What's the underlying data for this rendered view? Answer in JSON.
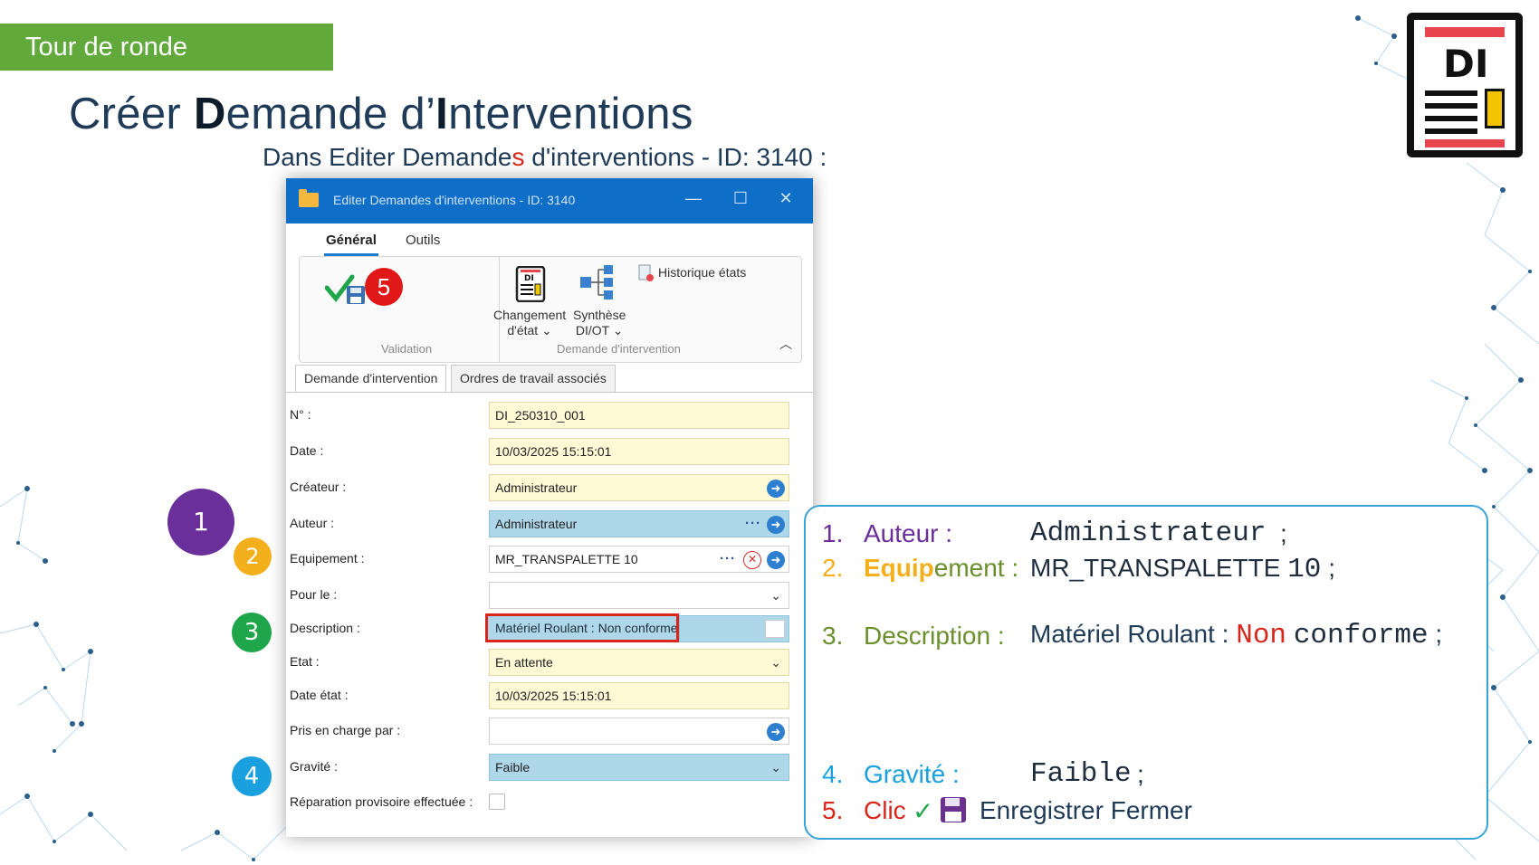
{
  "banner": "Tour de ronde",
  "title": {
    "part1": "Créer ",
    "bold1": "D",
    "part2": "emande d’",
    "bold2": "I",
    "part3": "nterventions"
  },
  "subtitle": {
    "a": "Dans Editer Demande",
    "s": "s",
    "b": " d'interventions - ID: 3140 :"
  },
  "logo": {
    "text": "DI"
  },
  "window": {
    "title": "Editer Demandes d'interventions - ID: 3140",
    "ribbon_tabs": [
      "Général",
      "Outils"
    ],
    "groups": {
      "validation": "Validation",
      "demande": "Demande d'intervention"
    },
    "buttons": {
      "changement": [
        "Changement",
        "d'état ⌄"
      ],
      "synthese": [
        "Synthèse",
        "DI/OT ⌄"
      ],
      "historique": "Historique états"
    },
    "form_tabs": [
      "Demande d'intervention",
      "Ordres de travail associés"
    ],
    "fields": {
      "numero": {
        "label": "N° :",
        "value": "DI_250310_001"
      },
      "date": {
        "label": "Date :",
        "value": "10/03/2025 15:15:01"
      },
      "createur": {
        "label": "Créateur :",
        "value": "Administrateur"
      },
      "auteur": {
        "label": "Auteur :",
        "value": "Administrateur"
      },
      "equipement": {
        "label": "Equipement :",
        "value": "MR_TRANSPALETTE 10"
      },
      "pour_le": {
        "label": "Pour le :",
        "value": ""
      },
      "description": {
        "label": "Description :",
        "value": "Matériel Roulant : Non conforme"
      },
      "etat": {
        "label": "Etat :",
        "value": "En attente"
      },
      "date_etat": {
        "label": "Date état :",
        "value": "10/03/2025 15:15:01"
      },
      "pris_en_charge": {
        "label": "Pris en charge par :",
        "value": ""
      },
      "gravite": {
        "label": "Gravité :",
        "value": "Faible"
      },
      "reparation": {
        "label": "Réparation provisoire effectuée :"
      }
    }
  },
  "steps": [
    "1",
    "2",
    "3",
    "4",
    "5"
  ],
  "step_colors": {
    "1": "#6a2f9a",
    "2": "#f4b01c",
    "3": "#1fa64a",
    "4": "#1aa0df",
    "5": "#e01818"
  },
  "summary": {
    "l1": {
      "num": "1.",
      "label": "Auteur :",
      "value": "Administrateur",
      "end": ";"
    },
    "l2": {
      "num": "2.",
      "label_a": "Equip",
      "label_b": "ement :",
      "value_a": "MR_TRANSPALETTE",
      "value_b": "10",
      "end": ";"
    },
    "l3": {
      "num": "3.",
      "label": "Description :",
      "value_a": "Matériel Roulant :",
      "value_b": "Non",
      "value_c": "conforme",
      "end": ";"
    },
    "l4": {
      "num": "4.",
      "label": "Gravité :",
      "value": "Faible",
      "end": ";"
    },
    "l5": {
      "num": "5.",
      "label": "Clic",
      "check": "✓",
      "value": "Enregistrer Fermer"
    }
  }
}
